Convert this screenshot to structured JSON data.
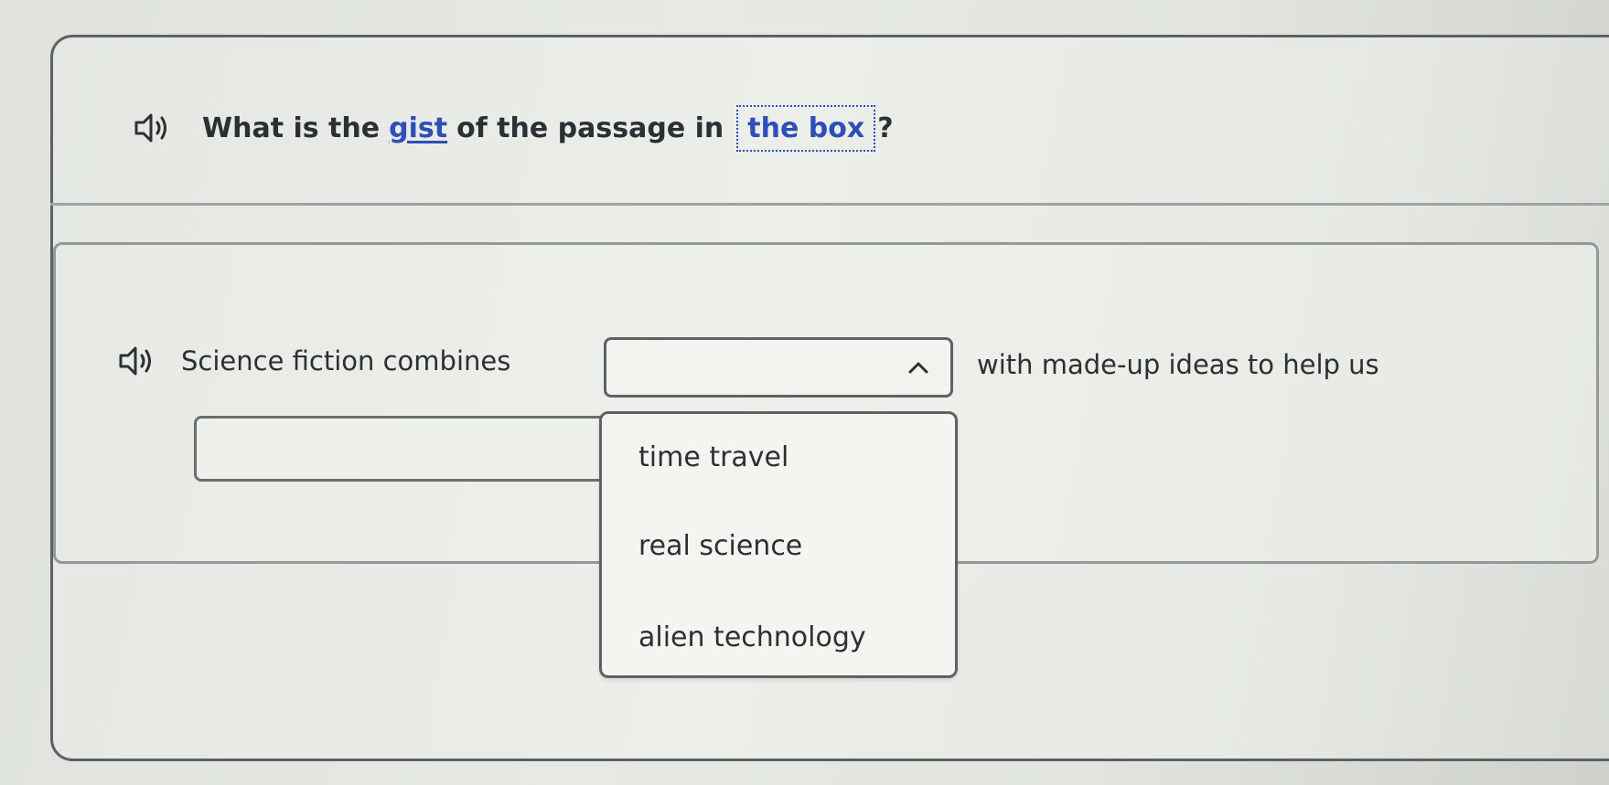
{
  "question": {
    "prompt_before": "What is the",
    "link_word": "gist",
    "prompt_middle": "of the passage in",
    "box_link": "the box",
    "prompt_after": "?"
  },
  "passage": {
    "sentence_lead": "Science fiction combines",
    "sentence_tail": "with made-up ideas to help us",
    "dropdown_one_value": "",
    "dropdown_two_value": "",
    "options": [
      "time travel",
      "real science",
      "alien technology"
    ]
  },
  "colors": {
    "link_blue": "#2e4fb8",
    "text_dark": "#2b3034",
    "border_gray": "#5c6266"
  },
  "icons": {
    "audio": "speaker-icon",
    "dropdown_open": "chevron-up-icon"
  }
}
